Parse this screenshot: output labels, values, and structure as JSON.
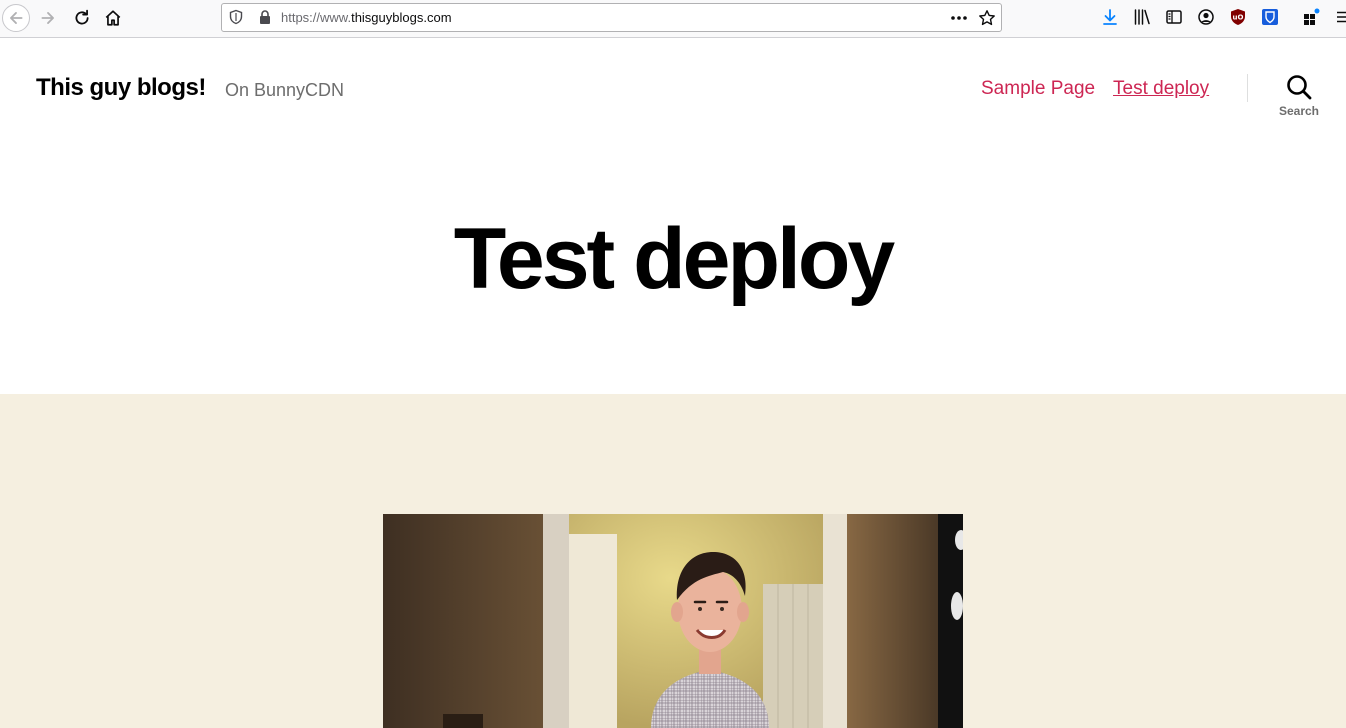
{
  "browser": {
    "url_prefix": "https://www.",
    "url_domain": "thisguyblogs.com",
    "icons": {
      "back": "back-arrow-icon",
      "forward": "forward-arrow-icon",
      "reload": "reload-icon",
      "home": "home-icon",
      "tracking": "shield-icon",
      "lock": "lock-icon",
      "page_actions": "more-dots-icon",
      "bookmark": "star-icon",
      "downloads": "download-icon",
      "library": "library-icon",
      "sidebar": "sidebar-icon",
      "account": "account-icon",
      "ublock": "ublock-icon",
      "bitwarden": "bitwarden-icon",
      "extensions": "extensions-icon",
      "menu": "hamburger-menu-icon"
    }
  },
  "site": {
    "title": "This guy blogs!",
    "description": "On BunnyCDN",
    "nav": [
      {
        "label": "Sample Page",
        "current": false
      },
      {
        "label": "Test deploy",
        "current": true
      }
    ],
    "search_label": "Search"
  },
  "post": {
    "title": "Test deploy",
    "image_alt": "man smiling in doorway"
  },
  "colors": {
    "accent": "#cd2653",
    "content_background": "#f5efe0",
    "header_background": "#ffffff",
    "muted_text": "#6d6d6d",
    "download_blue": "#0a84ff",
    "ublock_red": "#800000",
    "bitwarden_blue": "#175ddc"
  }
}
